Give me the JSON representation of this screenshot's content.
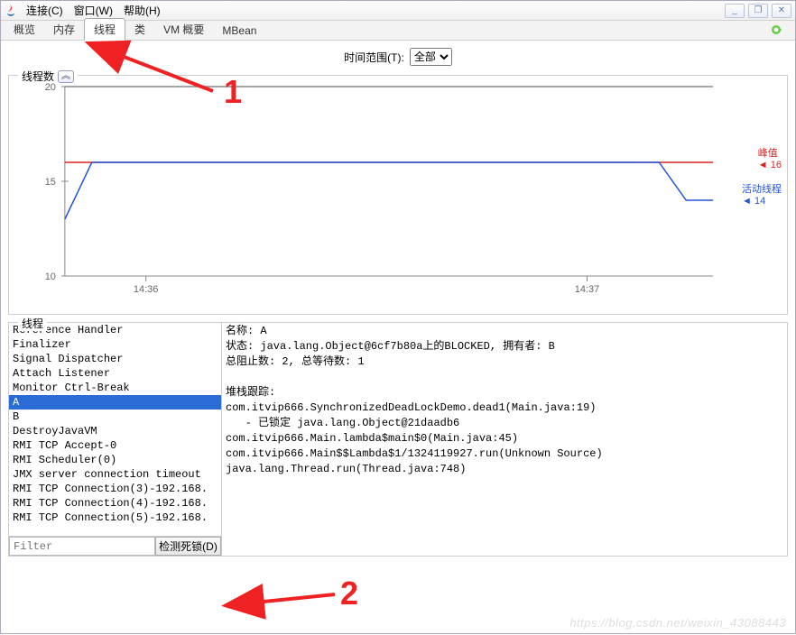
{
  "menus": {
    "connection": "连接(C)",
    "window": "窗口(W)",
    "help": "帮助(H)"
  },
  "window_buttons": {
    "min": "_",
    "max": "❐",
    "close": "✕"
  },
  "tabs": {
    "overview": "概览",
    "memory": "内存",
    "threads": "线程",
    "classes": "类",
    "vm_summary": "VM 概要",
    "mbean": "MBean"
  },
  "time_range_label": "时间范围(T):",
  "time_range_value": "全部",
  "chart_section_title": "线程数",
  "chart_legend": {
    "peak_label": "峰值",
    "peak_value": "16",
    "live_label": "活动线程",
    "live_value": "14"
  },
  "threads_section_title": "线程",
  "thread_list": [
    "Reference Handler",
    "Finalizer",
    "Signal Dispatcher",
    "Attach Listener",
    "Monitor Ctrl-Break",
    "A",
    "B",
    "DestroyJavaVM",
    "RMI TCP Accept-0",
    "RMI Scheduler(0)",
    "JMX server connection timeout",
    "RMI TCP Connection(3)-192.168.",
    "RMI TCP Connection(4)-192.168.",
    "RMI TCP Connection(5)-192.168."
  ],
  "selected_thread_index": 5,
  "detail": {
    "name_label": "名称:",
    "name_value": "A",
    "status_label": "状态:",
    "status_value": "java.lang.Object@6cf7b80a上的BLOCKED, 拥有者: B",
    "blocked_label": "总阻止数:",
    "blocked_value": "2,",
    "waited_label": "总等待数:",
    "waited_value": "1",
    "stack_label": "堆栈跟踪:",
    "stack": [
      "com.itvip666.SynchronizedDeadLockDemo.dead1(Main.java:19)",
      "   - 已锁定 java.lang.Object@21daadb6",
      "com.itvip666.Main.lambda$main$0(Main.java:45)",
      "com.itvip666.Main$$Lambda$1/1324119927.run(Unknown Source)",
      "java.lang.Thread.run(Thread.java:748)"
    ]
  },
  "filter_placeholder": "Filter",
  "deadlock_btn": "检测死锁(D)",
  "annotations": {
    "num1": "1",
    "num2": "2"
  },
  "watermark": "https://blog.csdn.net/weixin_43088443",
  "chart_data": {
    "type": "line",
    "x_ticks": [
      "14:36",
      "14:37"
    ],
    "ylim": [
      10,
      20
    ],
    "y_ticks": [
      10,
      15,
      20
    ],
    "series": [
      {
        "name": "峰值",
        "color": "#d22",
        "values": [
          16,
          16,
          16,
          16,
          16,
          16,
          16,
          16,
          16,
          16,
          16
        ]
      },
      {
        "name": "活动线程",
        "color": "#25d",
        "values": [
          13,
          16,
          16,
          16,
          16,
          16,
          16,
          16,
          16,
          16,
          14
        ]
      }
    ],
    "title": "线程数",
    "xlabel": "",
    "ylabel": ""
  }
}
